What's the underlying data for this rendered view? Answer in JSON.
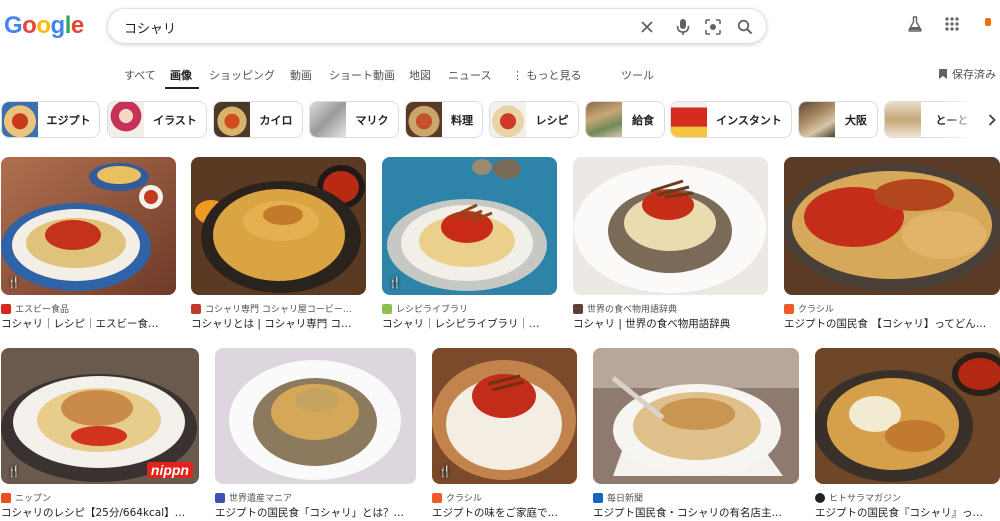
{
  "logo": {
    "letters": [
      "G",
      "o",
      "o",
      "g",
      "l",
      "e"
    ]
  },
  "search": {
    "query": "コシャリ"
  },
  "nav": {
    "items": [
      "すべて",
      "画像",
      "ショッピング",
      "動画",
      "ショート動画",
      "地図",
      "ニュース",
      "もっと見る",
      "ツール"
    ],
    "saved": "保存済み"
  },
  "chips": [
    "エジプト",
    "イラスト",
    "カイロ",
    "マリク",
    "料理",
    "レシピ",
    "給食",
    "インスタント",
    "大阪",
    "とーと"
  ],
  "results": [
    {
      "source": "エスビー食品",
      "title": "コシャリ｜レシピ｜エスビー食…",
      "recipe": true
    },
    {
      "source": "コシャリ専門 コシャリ屋コービー…",
      "title": "コシャリとは | コシャリ専門 コ…",
      "recipe": false
    },
    {
      "source": "レシピライブラリ",
      "title": "コシャリ｜レシピライブラリ｜…",
      "recipe": true
    },
    {
      "source": "世界の食べ物用語辞典",
      "title": "コシャリ | 世界の食べ物用語辞典",
      "recipe": false
    },
    {
      "source": "クラシル",
      "title": "エジプトの国民食 【コシャリ】ってどん…",
      "recipe": false
    },
    {
      "source": "ニップン",
      "title": "コシャリのレシピ【25分/664kcal】…",
      "recipe": true
    },
    {
      "source": "世界遺産マニア",
      "title": "エジプトの国民食「コシャリ」とは？…",
      "recipe": false
    },
    {
      "source": "クラシル",
      "title": "エジプトの味をご家庭で…",
      "recipe": true
    },
    {
      "source": "毎日新聞",
      "title": "エジプト国民食・コシャリの有名店主…",
      "recipe": false
    },
    {
      "source": "ヒトサラマガジン",
      "title": "エジプトの国民食『コシャリ』っ…",
      "recipe": false
    }
  ],
  "brand": {
    "nippn": "nippn"
  }
}
